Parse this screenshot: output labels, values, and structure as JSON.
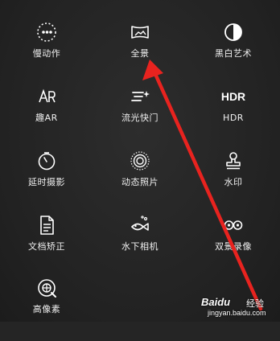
{
  "modes": {
    "slow_motion": {
      "label": "慢动作",
      "icon": "slow-motion-icon"
    },
    "panorama": {
      "label": "全景",
      "icon": "panorama-icon"
    },
    "bw_art": {
      "label": "黑白艺术",
      "icon": "bw-art-icon"
    },
    "fun_ar": {
      "label": "趣AR",
      "icon": "ar-icon"
    },
    "light_painting": {
      "label": "流光快门",
      "icon": "light-painting-icon"
    },
    "hdr": {
      "label": "HDR",
      "icon": "hdr-icon",
      "icon_text": "HDR"
    },
    "time_lapse": {
      "label": "延时摄影",
      "icon": "timer-icon"
    },
    "moving_picture": {
      "label": "动态照片",
      "icon": "moving-picture-icon"
    },
    "watermark": {
      "label": "水印",
      "icon": "stamp-icon"
    },
    "doc_scan": {
      "label": "文档矫正",
      "icon": "document-icon"
    },
    "underwater": {
      "label": "水下相机",
      "icon": "fish-icon"
    },
    "dual_view": {
      "label": "双景录像",
      "icon": "dual-view-icon"
    },
    "high_res": {
      "label": "高像素",
      "icon": "high-res-icon"
    }
  },
  "colors": {
    "background": "#252525",
    "text": "#f0f0f0",
    "arrow": "#e8231f"
  },
  "watermark_overlay": {
    "logo": "Baidu",
    "brand": "经验",
    "url": "jingyan.baidu.com"
  }
}
